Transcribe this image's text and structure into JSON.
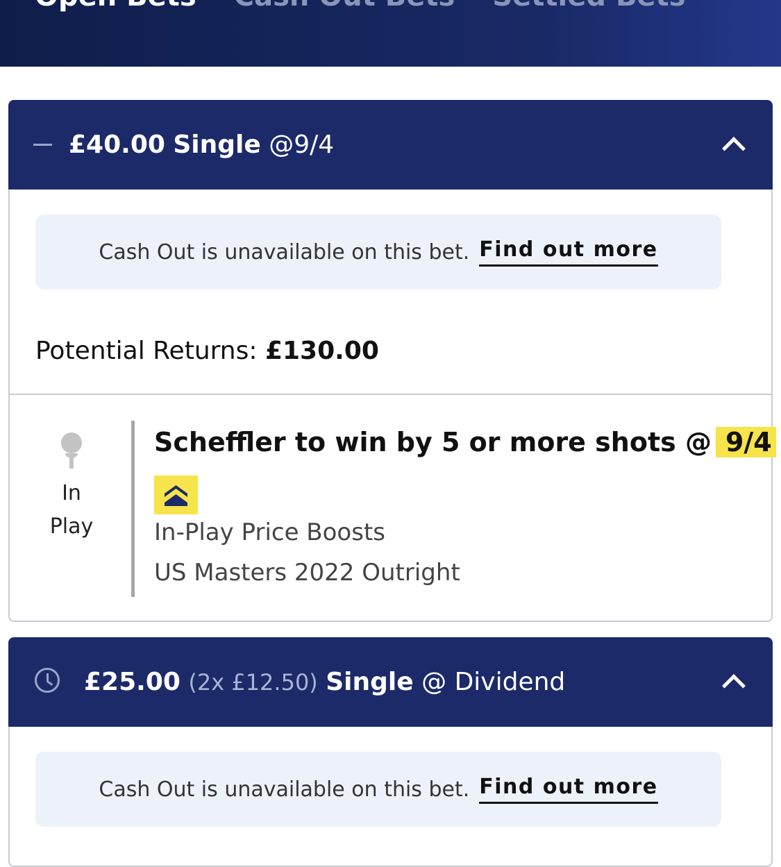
{
  "tabs": [
    {
      "label": "Open Bets",
      "active": true
    },
    {
      "label": "Cash Out Bets",
      "active": false
    },
    {
      "label": "Settled Bets",
      "active": false
    }
  ],
  "bets": [
    {
      "stake": "£40.00",
      "type": "Single",
      "at": "@",
      "odds": "9/4",
      "notice_text": "Cash Out is unavailable on this bet.",
      "notice_link": "Find out more",
      "returns_label": "Potential Returns:",
      "returns_amount": "£130.00",
      "status_line1": "In",
      "status_line2": "Play",
      "selection": "Scheffler to win by 5 or more shots @",
      "selection_odds": "9/4",
      "market": "In-Play Price Boosts",
      "event": "US Masters 2022 Outright"
    },
    {
      "stake": "£25.00",
      "breakdown": "(2x £12.50)",
      "type": "Single",
      "at": "@",
      "odds": "Dividend",
      "notice_text": "Cash Out is unavailable on this bet.",
      "notice_link": "Find out more"
    }
  ],
  "icons": {
    "bet1_header": "dash-icon",
    "bet2_header": "clock-icon",
    "collapse": "chevron-up-icon",
    "sport": "golf-tee-icon",
    "boost": "price-boost-icon"
  },
  "colors": {
    "header_bg": "#1c2a69",
    "boost_yellow": "#f7e34a",
    "notice_bg": "#edf2fa"
  }
}
